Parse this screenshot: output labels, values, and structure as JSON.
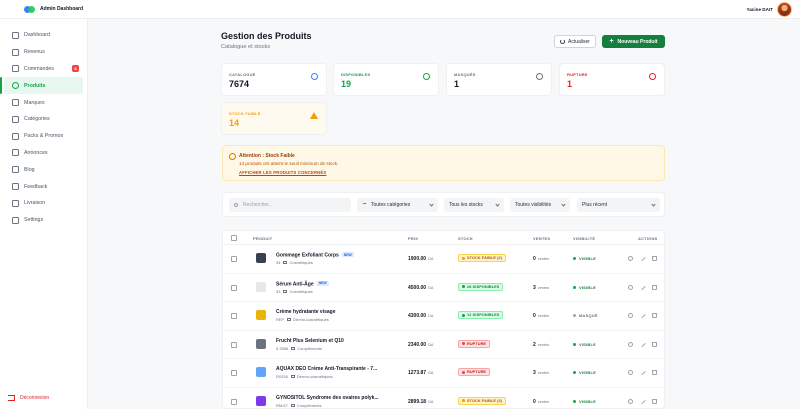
{
  "app": {
    "title": "Admin Dashboard"
  },
  "user": {
    "name": "Yacine DAIT"
  },
  "sidebar": {
    "items": [
      {
        "label": "Dashboard",
        "icon": "dashboard-icon"
      },
      {
        "label": "Revenus",
        "icon": "trend-icon"
      },
      {
        "label": "Commandes",
        "icon": "cart-icon",
        "badge": "8"
      },
      {
        "label": "Produits",
        "icon": "package-icon",
        "active": true
      },
      {
        "label": "Marques",
        "icon": "tag-icon"
      },
      {
        "label": "Catégories",
        "icon": "folder-icon"
      },
      {
        "label": "Packs & Promos",
        "icon": "gift-icon"
      },
      {
        "label": "Annonces",
        "icon": "megaphone-icon"
      },
      {
        "label": "Blog",
        "icon": "blog-icon"
      },
      {
        "label": "Feedback",
        "icon": "message-icon"
      },
      {
        "label": "Livraison",
        "icon": "truck-icon"
      },
      {
        "label": "Settings",
        "icon": "gear-icon"
      }
    ],
    "logout": "Déconnexion"
  },
  "header": {
    "title": "Gestion des Produits",
    "subtitle": "Catalogue et stocks",
    "refresh_label": "Actualiser",
    "new_label": "Nouveau Produit"
  },
  "stats": [
    {
      "label": "CATALOGUE",
      "value": "7674"
    },
    {
      "label": "DISPONIBLES",
      "value": "19"
    },
    {
      "label": "MASQUÉS",
      "value": "1"
    },
    {
      "label": "RUPTURE",
      "value": "1"
    },
    {
      "label": "STOCK FAIBLE",
      "value": "14"
    }
  ],
  "alert": {
    "title": "Attention : Stock Faible",
    "description": "14 produits ont atteint le seuil minimum de stock.",
    "link": "AFFICHER LES PRODUITS CONCERNÉS"
  },
  "filters": {
    "search_placeholder": "Rechercher...",
    "category": "Toutes catégories",
    "stock": "Tous les stocks",
    "visibility": "Toutes visibilités",
    "sort": "Plus récent"
  },
  "table": {
    "headers": [
      "PRODUIT",
      "PRIX",
      "STOCK",
      "VENTES",
      "VISIBILITÉ",
      "ACTIONS"
    ],
    "currency": "DA",
    "sales_unit": "ventes",
    "rows": [
      {
        "name": "Gommage Exfoliant Corps",
        "tag": "NEW",
        "ref": "34",
        "category": "Cosmétiques",
        "price": "1900.00",
        "stock": "STOCK FAIBLE (2)",
        "stock_status": "low",
        "sales": "0",
        "visibility": "VISIBLE"
      },
      {
        "name": "Sérum Anti-Âge",
        "tag": "NEW",
        "ref": "33",
        "category": "Cosmétiques",
        "price": "4500.00",
        "stock": "28 DISPONIBLES",
        "stock_status": "ok",
        "sales": "3",
        "visibility": "VISIBLE"
      },
      {
        "name": "Crème hydratante visage",
        "tag": "",
        "ref": "REF",
        "category": "Dermo-cosmétiques",
        "price": "4300.00",
        "stock": "12 DISPONIBLES",
        "stock_status": "ok",
        "sales": "0",
        "visibility": "MASQUÉ"
      },
      {
        "name": "Frucht Plus Selenium et Q10",
        "tag": "",
        "ref": "6 2896",
        "category": "Compléments",
        "price": "2340.00",
        "stock": "RUPTURE",
        "stock_status": "out",
        "sales": "2",
        "visibility": "VISIBLE"
      },
      {
        "name": "AQUAX DEO Crème Anti-Transpirante - 7...",
        "tag": "",
        "ref": "R0336",
        "category": "Dermo-cosmétiques",
        "price": "1273.87",
        "stock": "RUPTURE",
        "stock_status": "out",
        "sales": "3",
        "visibility": "VISIBLE"
      },
      {
        "name": "GYNOSITOL Syndrome des ovaires polyk...",
        "tag": "",
        "ref": "RM/47",
        "category": "Compléments",
        "price": "2899.18",
        "stock": "STOCK FAIBLE (3)",
        "stock_status": "low",
        "sales": "0",
        "visibility": "VISIBLE"
      }
    ]
  },
  "colors": {
    "accent": "#15803d",
    "danger": "#dc2626",
    "warning": "#f59e0b"
  }
}
